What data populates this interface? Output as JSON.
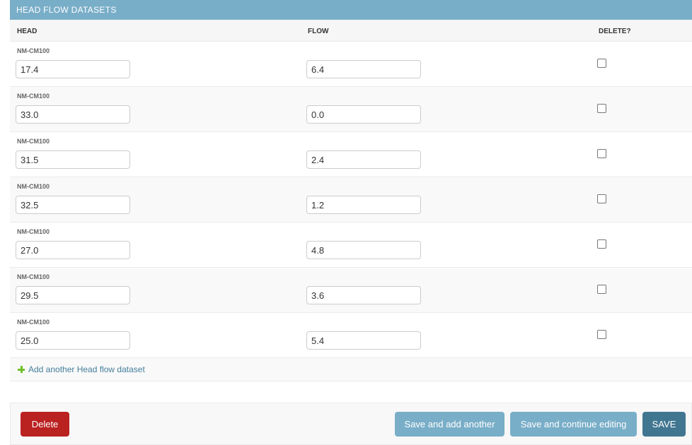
{
  "inline": {
    "title": "HEAD FLOW DATASETS",
    "columns": {
      "head": "HEAD",
      "flow": "FLOW",
      "delete": "DELETE?"
    },
    "rows": [
      {
        "original": "NM-CM100",
        "head": "17.4",
        "flow": "6.4",
        "delete": false
      },
      {
        "original": "NM-CM100",
        "head": "33.0",
        "flow": "0.0",
        "delete": false
      },
      {
        "original": "NM-CM100",
        "head": "31.5",
        "flow": "2.4",
        "delete": false
      },
      {
        "original": "NM-CM100",
        "head": "32.5",
        "flow": "1.2",
        "delete": false
      },
      {
        "original": "NM-CM100",
        "head": "27.0",
        "flow": "4.8",
        "delete": false
      },
      {
        "original": "NM-CM100",
        "head": "29.5",
        "flow": "3.6",
        "delete": false
      },
      {
        "original": "NM-CM100",
        "head": "25.0",
        "flow": "5.4",
        "delete": false
      }
    ],
    "add_link": "Add another Head flow dataset",
    "add_icon": "plus-icon"
  },
  "submit_row": {
    "delete_label": "Delete",
    "save_add_another_label": "Save and add another",
    "save_continue_label": "Save and continue editing",
    "save_label": "SAVE"
  },
  "colors": {
    "header_bg": "#79aec8",
    "delete_button": "#ba2121",
    "secondary_button": "#79aec8",
    "save_button": "#417690",
    "link": "#447e9b",
    "add_icon": "#70bf2b"
  }
}
